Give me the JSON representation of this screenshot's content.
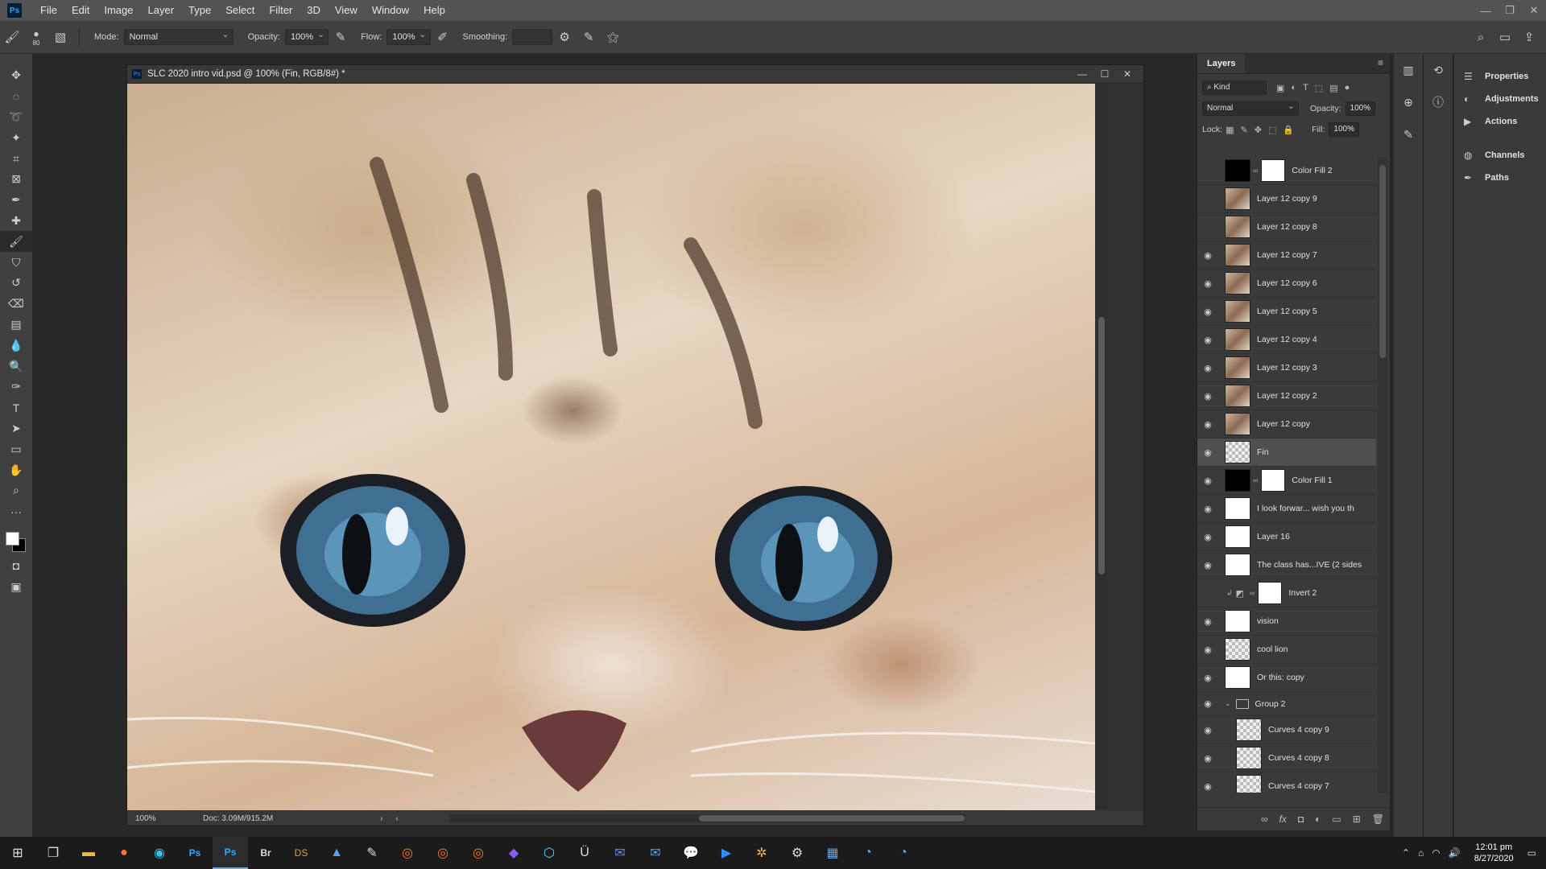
{
  "menubar": {
    "logo": "Ps",
    "items": [
      "File",
      "Edit",
      "Image",
      "Layer",
      "Type",
      "Select",
      "Filter",
      "3D",
      "View",
      "Window",
      "Help"
    ]
  },
  "options": {
    "brush_size": "80",
    "mode_label": "Mode:",
    "mode_value": "Normal",
    "opacity_label": "Opacity:",
    "opacity_value": "100%",
    "flow_label": "Flow:",
    "flow_value": "100%",
    "smoothing_label": "Smoothing:",
    "smoothing_value": ""
  },
  "document": {
    "title": "SLC 2020 intro vid.psd @ 100% (Fin, RGB/8#) *",
    "status_zoom": "100%",
    "status_info": "Doc: 3.09M/915.2M"
  },
  "layers_panel": {
    "tab": "Layers",
    "kind_label": "Kind",
    "blend_mode": "Normal",
    "opacity_label": "Opacity:",
    "opacity_value": "100%",
    "lock_label": "Lock:",
    "fill_label": "Fill:",
    "fill_value": "100%",
    "layers": [
      {
        "name": "Color Fill 2",
        "visible": false,
        "type": "fill"
      },
      {
        "name": "Layer 12 copy 9",
        "visible": false,
        "type": "photo"
      },
      {
        "name": "Layer 12 copy 8",
        "visible": false,
        "type": "photo"
      },
      {
        "name": "Layer 12 copy 7",
        "visible": true,
        "type": "photo"
      },
      {
        "name": "Layer 12 copy 6",
        "visible": true,
        "type": "photo"
      },
      {
        "name": "Layer 12 copy 5",
        "visible": true,
        "type": "photo"
      },
      {
        "name": "Layer 12 copy 4",
        "visible": true,
        "type": "photo"
      },
      {
        "name": "Layer 12 copy 3",
        "visible": true,
        "type": "photo"
      },
      {
        "name": "Layer 12 copy 2",
        "visible": true,
        "type": "photo"
      },
      {
        "name": "Layer 12 copy",
        "visible": true,
        "type": "photo"
      },
      {
        "name": "Fin",
        "visible": true,
        "type": "checker",
        "selected": true
      },
      {
        "name": "Color Fill 1",
        "visible": true,
        "type": "fill"
      },
      {
        "name": "I look forwar... wish you th",
        "visible": true,
        "type": "white"
      },
      {
        "name": "Layer 16",
        "visible": true,
        "type": "white"
      },
      {
        "name": "The class has...IVE  (2 sides",
        "visible": true,
        "type": "white"
      },
      {
        "name": "Invert 2",
        "visible": false,
        "type": "adjust"
      },
      {
        "name": "vision",
        "visible": true,
        "type": "white"
      },
      {
        "name": "cool lion",
        "visible": true,
        "type": "checker"
      },
      {
        "name": "Or this: copy",
        "visible": true,
        "type": "white"
      },
      {
        "name": "Group 2",
        "visible": true,
        "type": "group"
      },
      {
        "name": "Curves 4 copy 9",
        "visible": true,
        "type": "checker",
        "indent": true
      },
      {
        "name": "Curves 4 copy 8",
        "visible": true,
        "type": "checker",
        "indent": true
      },
      {
        "name": "Curves 4 copy 7",
        "visible": true,
        "type": "checker",
        "indent": true
      }
    ]
  },
  "right_panels": {
    "items": [
      "Properties",
      "Adjustments",
      "Actions",
      "Channels",
      "Paths"
    ]
  },
  "taskbar": {
    "time": "12:01 pm",
    "date": "8/27/2020",
    "icons": [
      "start-icon",
      "task-view-icon",
      "file-explorer-icon",
      "firefox-icon",
      "edge-icon",
      "photoshop-icon",
      "photoshop-active-icon",
      "bridge-icon",
      "daz-studio-icon",
      "photos-icon",
      "inkscape-icon",
      "blender-icon",
      "blender-icon-2",
      "blender-icon-3",
      "krita-icon",
      "vectorworks-icon",
      "unreal-icon",
      "outlook-icon",
      "mail-icon",
      "chat-icon",
      "zoom-icon",
      "slack-icon",
      "settings-icon",
      "calculator-icon",
      "browser-icon",
      "browser-icon-2"
    ]
  }
}
